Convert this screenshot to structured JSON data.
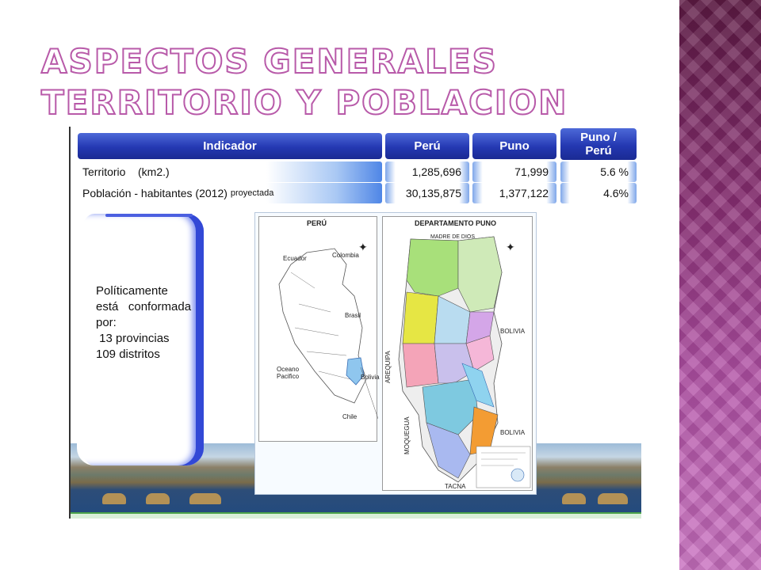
{
  "title": {
    "line1": "ASPECTOS GENERALES",
    "line2": "TERRITORIO Y POBLACION"
  },
  "table": {
    "headers": [
      "Indicador",
      "Perú",
      "Puno",
      "Puno / Perú"
    ],
    "rows": [
      {
        "label": "Territorio    (km2.)",
        "note": "",
        "peru": "1,285,696",
        "puno": "71,999",
        "ratio": "5.6 %"
      },
      {
        "label": "Población - habitantes (2012)",
        "note": "proyectada",
        "peru": "30,135,875",
        "puno": "1,377,122",
        "ratio": "4.6%"
      }
    ]
  },
  "info_card": {
    "lines": [
      "Políticamente",
      "está   conformada",
      "por:",
      " 13 provincias",
      "109 distritos"
    ]
  },
  "map": {
    "peru_title": "PERÚ",
    "puno_title": "DEPARTAMENTO PUNO",
    "peru_labels": [
      "Ecuador",
      "Colombia",
      "Brasil",
      "Oceano Pacifico",
      "Bolivia",
      "Chile"
    ],
    "puno_labels": [
      "MADRE DE DIOS",
      "BOLIVIA",
      "BOLIVIA",
      "AREQUIPA",
      "MOQUEGUA",
      "TACNA"
    ]
  },
  "colors": {
    "header_blue": "#2438b2",
    "title_stroke": "#b85aa9",
    "strip_magenta": "#8a2f74"
  }
}
